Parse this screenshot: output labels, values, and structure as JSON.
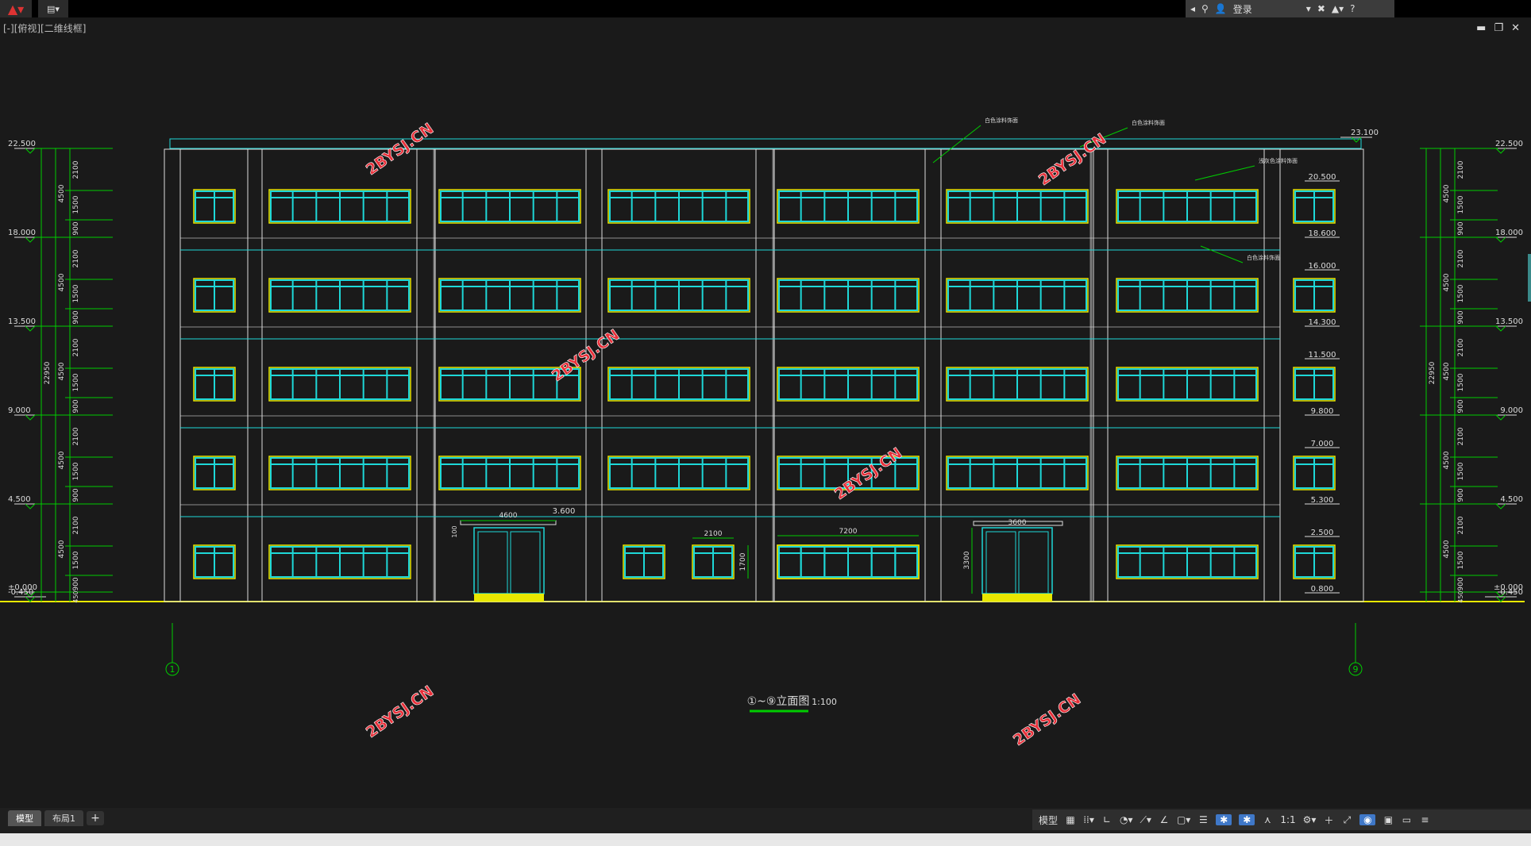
{
  "app": {
    "view_label": "[-][俯视][二维线框]",
    "login": "登录",
    "help": "?",
    "win_min": "▬",
    "win_restore": "❐",
    "win_close": "✕"
  },
  "drawing": {
    "title": "①~⑨立面图",
    "scale": "1:100",
    "watermark": "2BYSJ.CN",
    "axis_left": "1",
    "axis_right": "9",
    "left_elevations": [
      "22.500",
      "18.000",
      "13.500",
      "9.000",
      "4.500",
      "±0.000",
      "-0.450"
    ],
    "right_elevations": [
      "22.500",
      "18.000",
      "13.500",
      "9.000",
      "4.500",
      "±0.000",
      "-0.450"
    ],
    "total_height": "22950",
    "story_dims": [
      "4500",
      "4500",
      "4500",
      "4500",
      "4500"
    ],
    "sub_dims": [
      "2100",
      "1500",
      "900"
    ],
    "plinth_dim": "450",
    "roof_level": "23.100",
    "window_levels": [
      "20.500",
      "18.600",
      "16.000",
      "14.300",
      "11.500",
      "9.800",
      "7.000",
      "5.300",
      "2.500",
      "0.800"
    ],
    "notes": [
      "白色涂料饰面",
      "白色涂料饰面",
      "浅灰色涂料饰面",
      "白色涂料饰面"
    ],
    "dims": {
      "canopy_left_width": "4600",
      "canopy_left_level": "3.600",
      "canopy_left_thick": "100",
      "small_window_width": "2100",
      "small_window_height": "1700",
      "band_window_width": "7200",
      "entrance_width": "3600",
      "entrance_height": "3300"
    }
  },
  "status": {
    "tab_model": "模型",
    "tab_layout": "布局1",
    "tab_add": "+",
    "model_label": "模型",
    "scale": "1:1"
  },
  "colors": {
    "cyan": "#1ed8d8",
    "yellow": "#e8e800",
    "green": "#00cc00",
    "white": "#dcdcdc",
    "watermark": "#e8303a"
  }
}
